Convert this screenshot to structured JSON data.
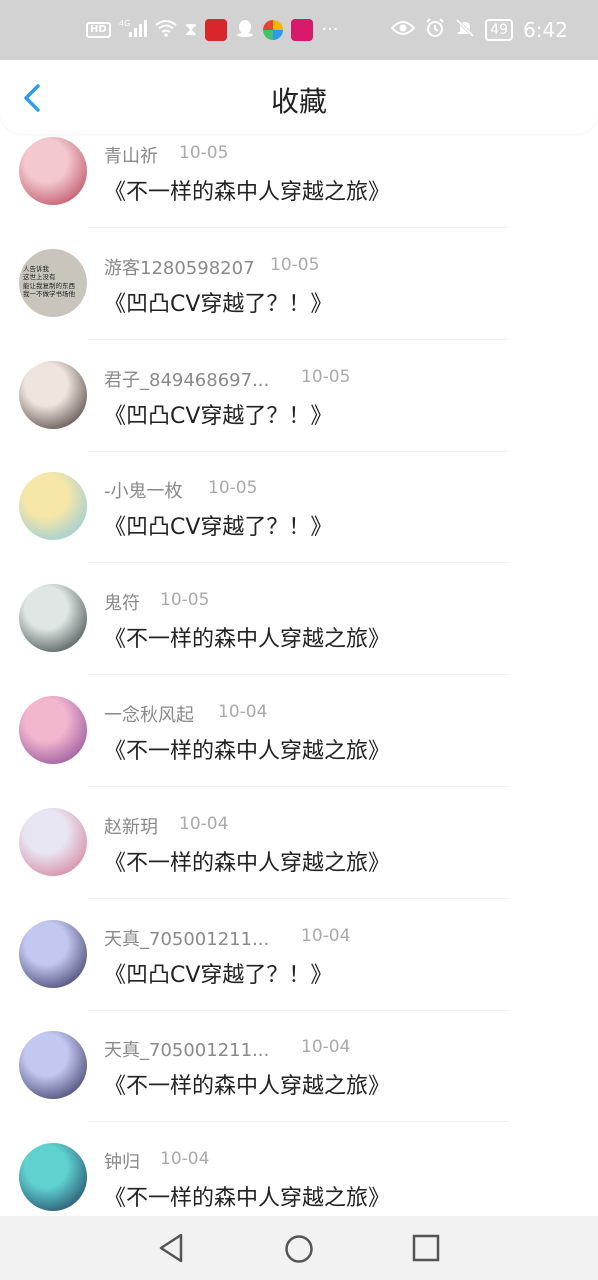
{
  "status_bar": {
    "left_icons": [
      "hd-icon",
      "signal-4g-icon",
      "wifi-icon",
      "hourglass-icon",
      "app-red-icon",
      "qq-icon",
      "app-multicolor-icon",
      "app-pink-icon",
      "more-dots-icon"
    ],
    "hd_label": "HD",
    "network_label": "4G",
    "battery_level": "49",
    "time": "6:42"
  },
  "header": {
    "title": "收藏",
    "back_icon": "back-chevron-icon"
  },
  "favorites": [
    {
      "user": "青山祈",
      "date": "10-05",
      "book": "《不一样的森中人穿越之旅》",
      "avatar_colors": [
        "#f3c9cf",
        "#b0324a"
      ]
    },
    {
      "user": "游客1280598207",
      "date": "10-05",
      "book": "《凹凸CV穿越了？！》",
      "avatar_colors": [
        "#c9c5bd",
        "#9a958e"
      ],
      "avatar_text": [
        "人告诉我",
        "这世上没有",
        "能让我复制的东西",
        "我一不做学书场他"
      ]
    },
    {
      "user": "君子_849468697...",
      "date": "10-05",
      "book": "《凹凸CV穿越了？！》",
      "avatar_colors": [
        "#f0e4de",
        "#2b1f1d"
      ]
    },
    {
      "user": "-小鬼一枚",
      "date": "10-05",
      "book": "《凹凸CV穿越了？！》",
      "avatar_colors": [
        "#f6e7a8",
        "#7ec5e6"
      ]
    },
    {
      "user": "鬼符",
      "date": "10-05",
      "book": "《不一样的森中人穿越之旅》",
      "avatar_colors": [
        "#dfe6e3",
        "#1c2a2a"
      ]
    },
    {
      "user": "一念秋风起",
      "date": "10-04",
      "book": "《不一样的森中人穿越之旅》",
      "avatar_colors": [
        "#f3b6cf",
        "#7b3b8e"
      ]
    },
    {
      "user": "赵新玥",
      "date": "10-04",
      "book": "《不一样的森中人穿越之旅》",
      "avatar_colors": [
        "#e8e6f2",
        "#d06c8a"
      ]
    },
    {
      "user": "天真_705001211...",
      "date": "10-04",
      "book": "《凹凸CV穿越了？！》",
      "avatar_colors": [
        "#c3c8f0",
        "#1f1d4a"
      ]
    },
    {
      "user": "天真_705001211...",
      "date": "10-04",
      "book": "《不一样的森中人穿越之旅》",
      "avatar_colors": [
        "#c3c8f0",
        "#1f1d4a"
      ]
    },
    {
      "user": "钟归",
      "date": "10-04",
      "book": "《不一样的森中人穿越之旅》",
      "avatar_colors": [
        "#5fd2d0",
        "#16284e"
      ]
    }
  ],
  "nav_bar": [
    "back-triangle-icon",
    "home-circle-icon",
    "recents-square-icon"
  ],
  "colors": {
    "accent": "#2e9bf0",
    "username": "#8a8a8a",
    "date": "#aaaaaa",
    "title": "#222222"
  }
}
